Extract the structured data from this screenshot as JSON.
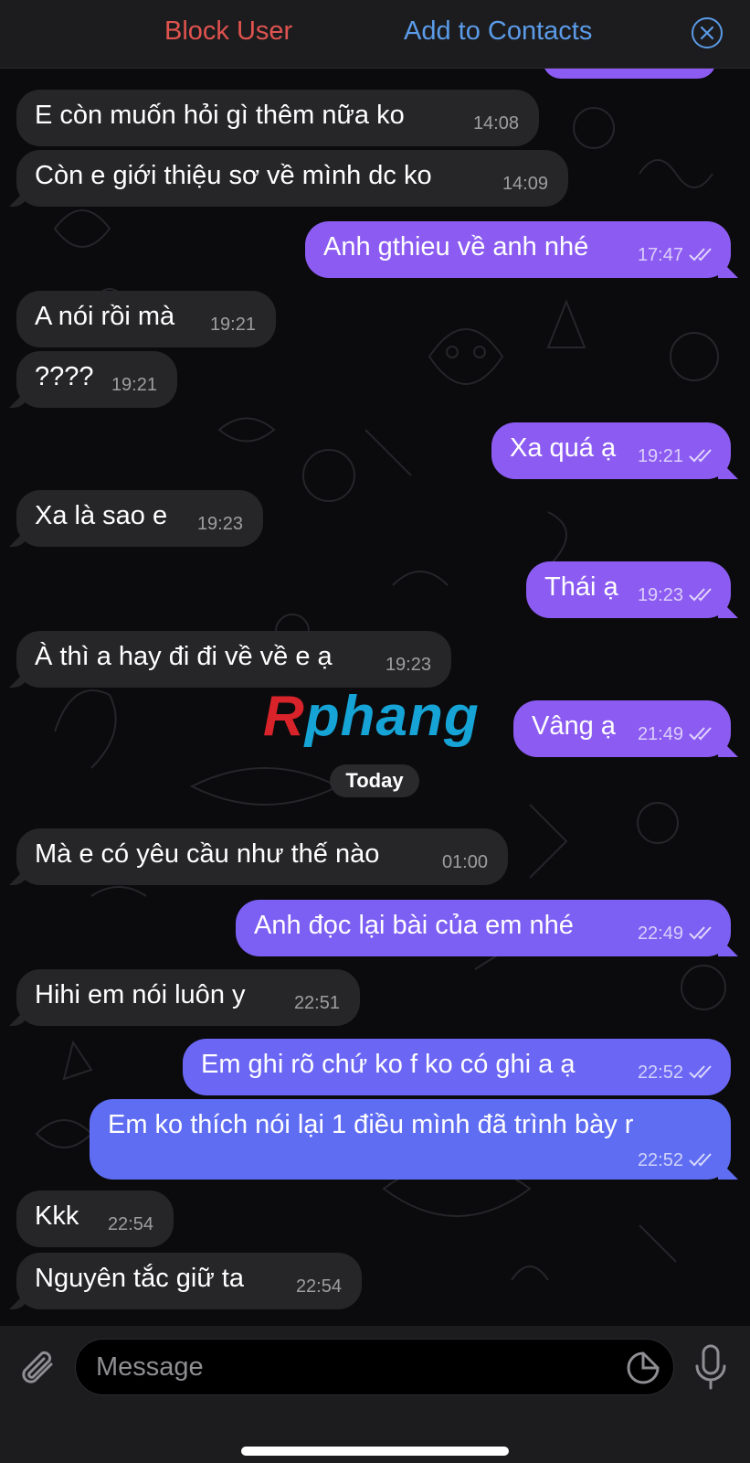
{
  "topbar": {
    "block_label": "Block User",
    "add_label": "Add to Contacts"
  },
  "messages": [
    {
      "text": "E còn muốn hỏi gì thêm nữa ko",
      "time": "14:08"
    },
    {
      "text": "Còn e giới thiệu sơ về mình dc ko",
      "time": "14:09"
    },
    {
      "text": "Anh gthieu về anh nhé",
      "time": "17:47"
    },
    {
      "text": "A nói rồi mà",
      "time": "19:21"
    },
    {
      "text": "????",
      "time": "19:21"
    },
    {
      "text": "Xa quá ạ",
      "time": "19:21"
    },
    {
      "text": "Xa là sao e",
      "time": "19:23"
    },
    {
      "text": "Thái ạ",
      "time": "19:23"
    },
    {
      "text": "À thì a hay đi đi về về e ạ",
      "time": "19:23"
    },
    {
      "text": "Vâng ạ",
      "time": "21:49"
    },
    {
      "text": "Mà e có yêu cầu như thế nào",
      "time": "01:00"
    },
    {
      "text": "Anh đọc lại bài của em nhé",
      "time": "22:49"
    },
    {
      "text": "Hihi em nói luôn y",
      "time": "22:51"
    },
    {
      "text": "Em ghi rõ chứ ko f ko có ghi a ạ",
      "time": "22:52"
    },
    {
      "text": "Em ko thích nói lại 1 điều mình đã trình bày r",
      "time": "22:52"
    },
    {
      "text": "Kkk",
      "time": "22:54"
    },
    {
      "text": "Nguyên tắc giữ ta",
      "time": "22:54"
    }
  ],
  "date_separator": "Today",
  "watermark": {
    "first": "R",
    "rest": "phang"
  },
  "composer": {
    "placeholder": "Message"
  },
  "colors": {
    "incoming": "#262628",
    "outgoing": "#8c5cf2",
    "block": "#e0534f",
    "link": "#5b9be8"
  }
}
